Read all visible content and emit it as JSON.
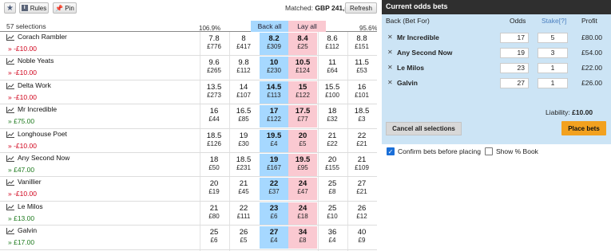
{
  "toolbar": {
    "star_icon": "star-icon",
    "rules_label": "Rules",
    "pin_label": "Pin",
    "matched_label": "Matched:",
    "matched_value": "GBP 241,640",
    "refresh_label": "Refresh"
  },
  "market_header": {
    "selections_count": "57 selections",
    "back_overround": "106.9%",
    "lay_overround": "95.6%",
    "back_all_label": "Back all",
    "lay_all_label": "Lay all"
  },
  "runners": [
    {
      "name": "Corach Rambler",
      "pl": "» -£10.00",
      "pl_sign": "neg",
      "back": [
        {
          "odds": "7.8",
          "amt": "£776"
        },
        {
          "odds": "8",
          "amt": "£417"
        },
        {
          "odds": "8.2",
          "amt": "£309"
        }
      ],
      "lay": [
        {
          "odds": "8.4",
          "amt": "£25"
        },
        {
          "odds": "8.6",
          "amt": "£112"
        },
        {
          "odds": "8.8",
          "amt": "£151"
        }
      ]
    },
    {
      "name": "Noble Yeats",
      "pl": "» -£10.00",
      "pl_sign": "neg",
      "back": [
        {
          "odds": "9.6",
          "amt": "£265"
        },
        {
          "odds": "9.8",
          "amt": "£112"
        },
        {
          "odds": "10",
          "amt": "£230"
        }
      ],
      "lay": [
        {
          "odds": "10.5",
          "amt": "£124"
        },
        {
          "odds": "11",
          "amt": "£64"
        },
        {
          "odds": "11.5",
          "amt": "£53"
        }
      ]
    },
    {
      "name": "Delta Work",
      "pl": "» -£10.00",
      "pl_sign": "neg",
      "back": [
        {
          "odds": "13.5",
          "amt": "£273"
        },
        {
          "odds": "14",
          "amt": "£107"
        },
        {
          "odds": "14.5",
          "amt": "£113"
        }
      ],
      "lay": [
        {
          "odds": "15",
          "amt": "£122"
        },
        {
          "odds": "15.5",
          "amt": "£100"
        },
        {
          "odds": "16",
          "amt": "£101"
        }
      ]
    },
    {
      "name": "Mr Incredible",
      "pl": "» £75.00",
      "pl_sign": "pos",
      "back": [
        {
          "odds": "16",
          "amt": "£44"
        },
        {
          "odds": "16.5",
          "amt": "£85"
        },
        {
          "odds": "17",
          "amt": "£122"
        }
      ],
      "lay": [
        {
          "odds": "17.5",
          "amt": "£77"
        },
        {
          "odds": "18",
          "amt": "£32"
        },
        {
          "odds": "18.5",
          "amt": "£3"
        }
      ]
    },
    {
      "name": "Longhouse Poet",
      "pl": "» -£10.00",
      "pl_sign": "neg",
      "back": [
        {
          "odds": "18.5",
          "amt": "£126"
        },
        {
          "odds": "19",
          "amt": "£30"
        },
        {
          "odds": "19.5",
          "amt": "£4"
        }
      ],
      "lay": [
        {
          "odds": "20",
          "amt": "£5"
        },
        {
          "odds": "21",
          "amt": "£22"
        },
        {
          "odds": "22",
          "amt": "£21"
        }
      ]
    },
    {
      "name": "Any Second Now",
      "pl": "» £47.00",
      "pl_sign": "pos",
      "back": [
        {
          "odds": "18",
          "amt": "£50"
        },
        {
          "odds": "18.5",
          "amt": "£231"
        },
        {
          "odds": "19",
          "amt": "£167"
        }
      ],
      "lay": [
        {
          "odds": "19.5",
          "amt": "£95"
        },
        {
          "odds": "20",
          "amt": "£155"
        },
        {
          "odds": "21",
          "amt": "£109"
        }
      ]
    },
    {
      "name": "Vanillier",
      "pl": "» -£10.00",
      "pl_sign": "neg",
      "back": [
        {
          "odds": "20",
          "amt": "£19"
        },
        {
          "odds": "21",
          "amt": "£45"
        },
        {
          "odds": "22",
          "amt": "£37"
        }
      ],
      "lay": [
        {
          "odds": "24",
          "amt": "£47"
        },
        {
          "odds": "25",
          "amt": "£8"
        },
        {
          "odds": "27",
          "amt": "£21"
        }
      ]
    },
    {
      "name": "Le Milos",
      "pl": "» £13.00",
      "pl_sign": "pos",
      "back": [
        {
          "odds": "21",
          "amt": "£80"
        },
        {
          "odds": "22",
          "amt": "£111"
        },
        {
          "odds": "23",
          "amt": "£6"
        }
      ],
      "lay": [
        {
          "odds": "24",
          "amt": "£18"
        },
        {
          "odds": "25",
          "amt": "£10"
        },
        {
          "odds": "26",
          "amt": "£12"
        }
      ]
    },
    {
      "name": "Galvin",
      "pl": "» £17.00",
      "pl_sign": "pos",
      "back": [
        {
          "odds": "25",
          "amt": "£6"
        },
        {
          "odds": "26",
          "amt": "£5"
        },
        {
          "odds": "27",
          "amt": "£4"
        }
      ],
      "lay": [
        {
          "odds": "34",
          "amt": "£8"
        },
        {
          "odds": "36",
          "amt": "£4"
        },
        {
          "odds": "40",
          "amt": "£9"
        }
      ]
    }
  ],
  "betslip": {
    "title": "Current odds bets",
    "col_back": "Back (Bet For)",
    "col_odds": "Odds",
    "col_stake": "Stake[?]",
    "col_profit": "Profit",
    "bets": [
      {
        "name": "Mr Incredible",
        "odds": "17",
        "stake": "5",
        "profit": "£80.00"
      },
      {
        "name": "Any Second Now",
        "odds": "19",
        "stake": "3",
        "profit": "£54.00"
      },
      {
        "name": "Le Milos",
        "odds": "23",
        "stake": "1",
        "profit": "£22.00"
      },
      {
        "name": "Galvin",
        "odds": "27",
        "stake": "1",
        "profit": "£26.00"
      }
    ],
    "liability_label": "Liability:",
    "liability_value": "£10.00",
    "cancel_all_label": "Cancel all selections",
    "place_bets_label": "Place bets",
    "confirm_label": "Confirm bets before placing",
    "confirm_checked": true,
    "book_label": "Show % Book",
    "book_checked": false
  },
  "colors": {
    "back": "#a6d8ff",
    "lay": "#fac9d1",
    "betslip_bg": "#cce4f5",
    "header_dark": "#2f2f2f",
    "place_bets": "#f2a11f",
    "loss": "#d0021b",
    "gain": "#1e7a1e"
  }
}
